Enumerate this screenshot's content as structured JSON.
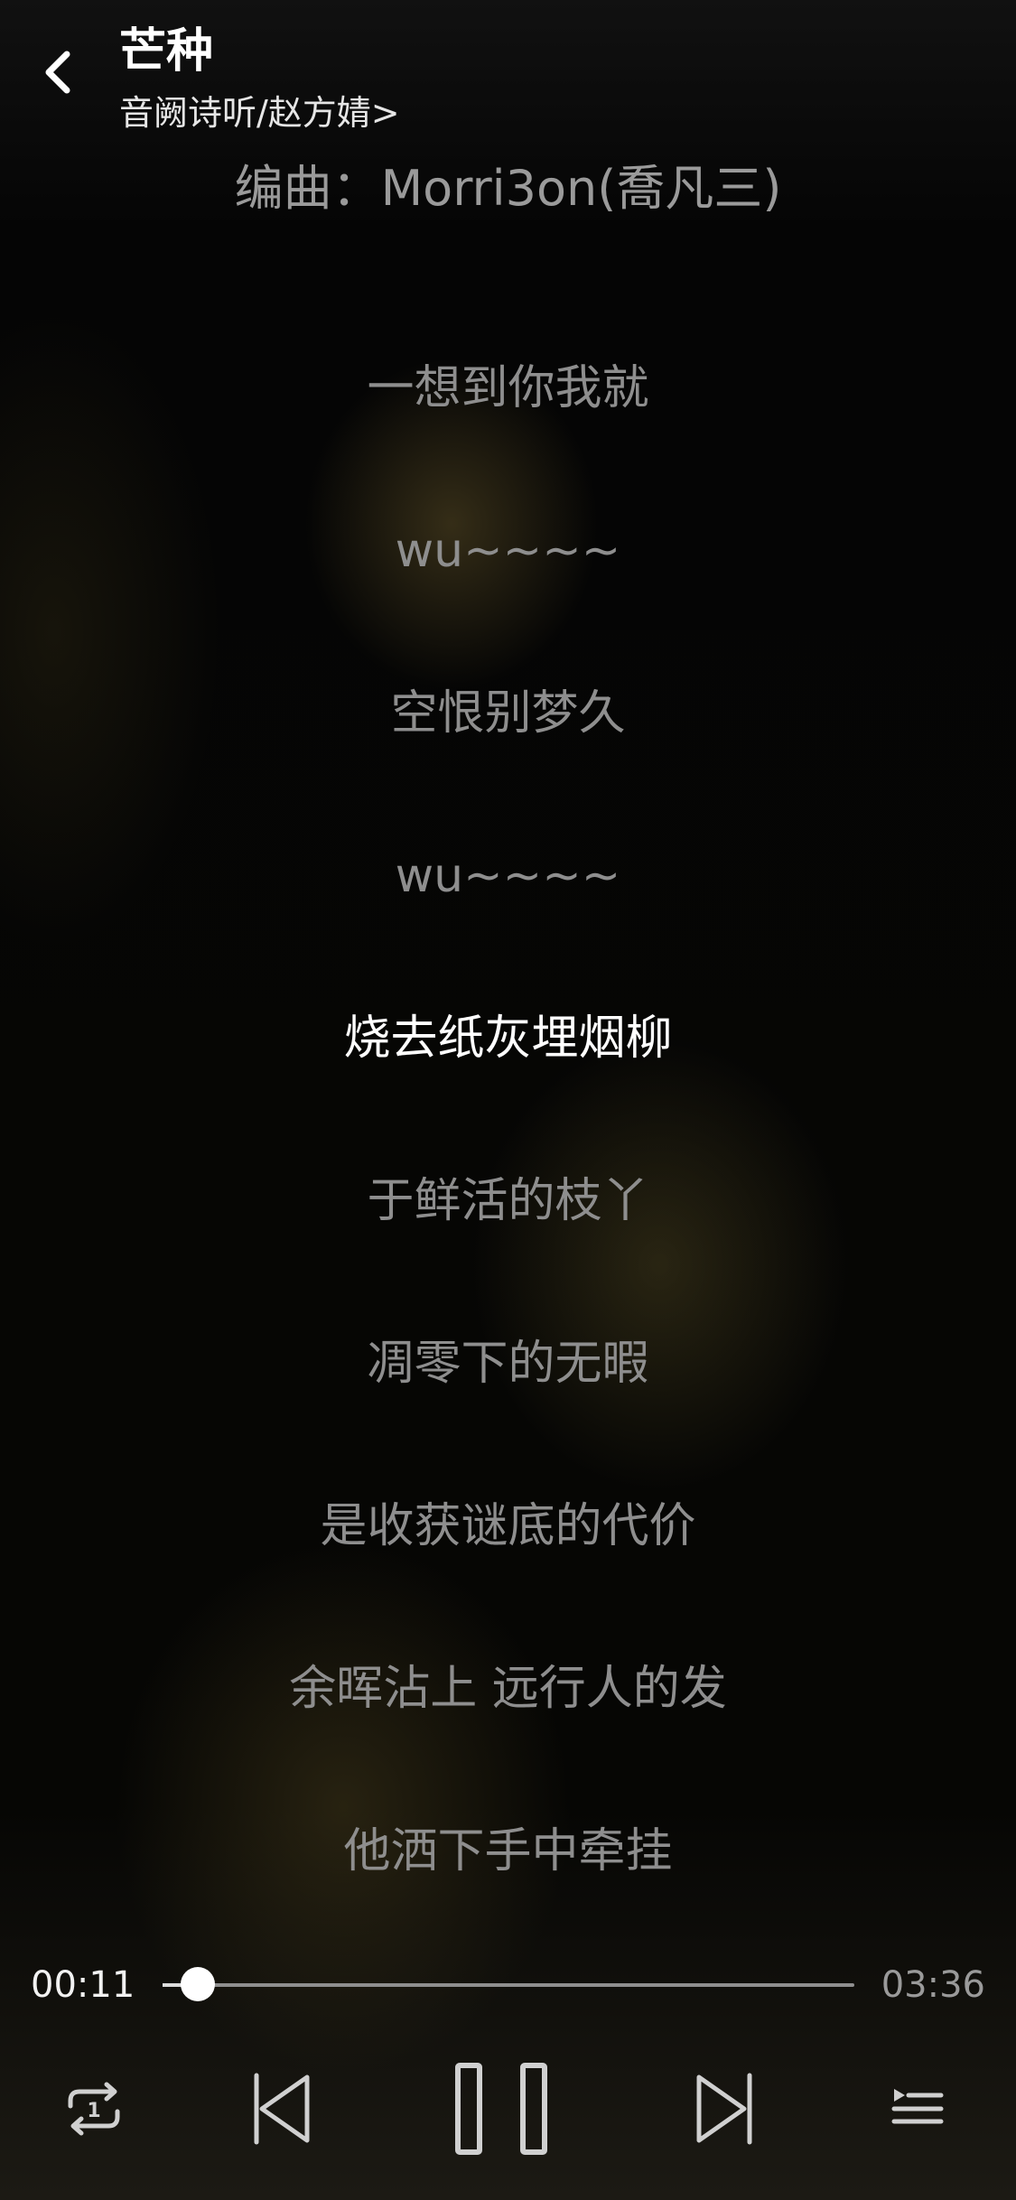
{
  "header": {
    "back_icon": "chevron-left-icon",
    "title": "芒种",
    "artist": "音阙诗听/赵方婧>",
    "credit": "编曲：Morri3on(喬凡三)"
  },
  "lyrics": [
    "一想到你我就",
    "wu~~~~",
    "空恨别梦久",
    "wu~~~~",
    "烧去纸灰埋烟柳",
    "于鲜活的枝丫",
    "凋零下的无暇",
    "是收获谜底的代价",
    "余晖沾上 远行人的发",
    "他洒下手中牵挂"
  ],
  "active_lyric_index": 4,
  "player": {
    "current_time": "00:11",
    "total_time": "03:36",
    "progress": 0.051,
    "repeat_icon": "repeat-one-icon",
    "prev_icon": "skip-previous-icon",
    "pause_icon": "pause-icon",
    "next_icon": "skip-next-icon",
    "playlist_icon": "playlist-icon"
  },
  "colors": {
    "active_lyric": "#ffffff",
    "inactive_lyric": "#8e8e8e",
    "icon": "#d0d0d0"
  }
}
